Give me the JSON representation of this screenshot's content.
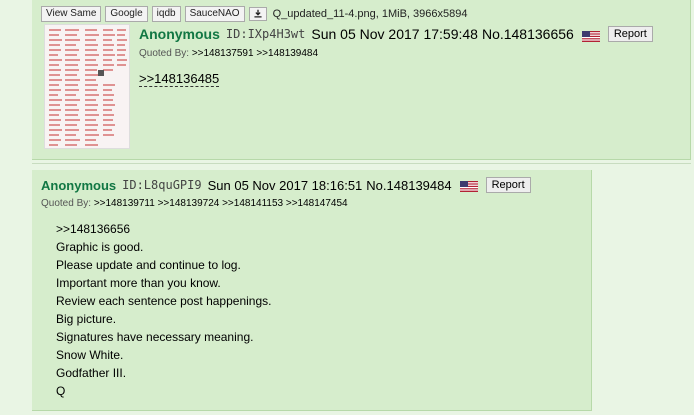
{
  "post1": {
    "file_buttons": [
      "View Same",
      "Google",
      "iqdb",
      "SauceNAO"
    ],
    "file_info": "Q_updated_11-4.png, 1MiB, 3966x5894",
    "name": "Anonymous",
    "id": "ID:IXp4H3wt",
    "date": "Sun 05 Nov 2017 17:59:48",
    "no": "No.148136656",
    "report": "Report",
    "quoted_label": "Quoted By:",
    "quoted_links": ">>148137591 >>148139484",
    "reply_link": ">>148136485"
  },
  "post2": {
    "name": "Anonymous",
    "id": "ID:L8quGPI9",
    "date": "Sun 05 Nov 2017 18:16:51",
    "no": "No.148139484",
    "report": "Report",
    "quoted_label": "Quoted By:",
    "quoted_links": ">>148139711 >>148139724 >>148141153 >>148147454",
    "lines": [
      ">>148136656",
      "Graphic is good.",
      "Please update and continue to log.",
      "Important more than you know.",
      "Review each sentence post happenings.",
      "Big picture.",
      "Signatures have necessary meaning.",
      "Snow White.",
      "Godfather III.",
      "Q"
    ]
  },
  "icons": {
    "download": "download-icon",
    "flag": "us-flag-icon"
  },
  "colors": {
    "post_bg": "#d6edcc",
    "page_bg": "#e9f5e4",
    "name": "#117743"
  }
}
